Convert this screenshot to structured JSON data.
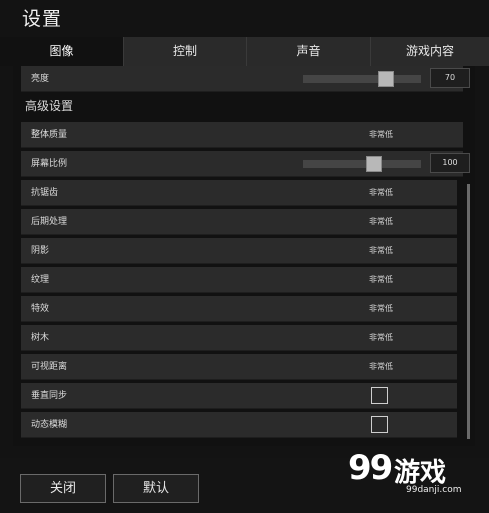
{
  "window": {
    "title": "设置"
  },
  "tabs": [
    {
      "label": "图像",
      "active": true
    },
    {
      "label": "控制",
      "active": false
    },
    {
      "label": "声音",
      "active": false
    },
    {
      "label": "游戏内容",
      "active": false
    }
  ],
  "brightness": {
    "label": "亮度",
    "value": "70",
    "level": 0.7
  },
  "advanced": {
    "section_title": "高级设置",
    "overall_quality": {
      "label": "整体质量",
      "value": "非常低"
    },
    "screen_ratio": {
      "label": "屏幕比例",
      "value": "100",
      "level": 0.6
    },
    "antialiasing": {
      "label": "抗锯齿",
      "value": "非常低"
    },
    "post_processing": {
      "label": "后期处理",
      "value": "非常低"
    },
    "shadow": {
      "label": "阴影",
      "value": "非常低"
    },
    "texture": {
      "label": "纹理",
      "value": "非常低"
    },
    "effects": {
      "label": "特效",
      "value": "非常低"
    },
    "trees": {
      "label": "树木",
      "value": "非常低"
    },
    "view_distance": {
      "label": "可视距离",
      "value": "非常低"
    },
    "vsync": {
      "label": "垂直同步",
      "checked": false
    },
    "motion_blur": {
      "label": "动态模糊",
      "checked": false
    }
  },
  "footer": {
    "close_label": "关闭",
    "default_label": "默认"
  },
  "watermark": {
    "logo": "99",
    "text": "游戏",
    "url": "99danji.com"
  }
}
